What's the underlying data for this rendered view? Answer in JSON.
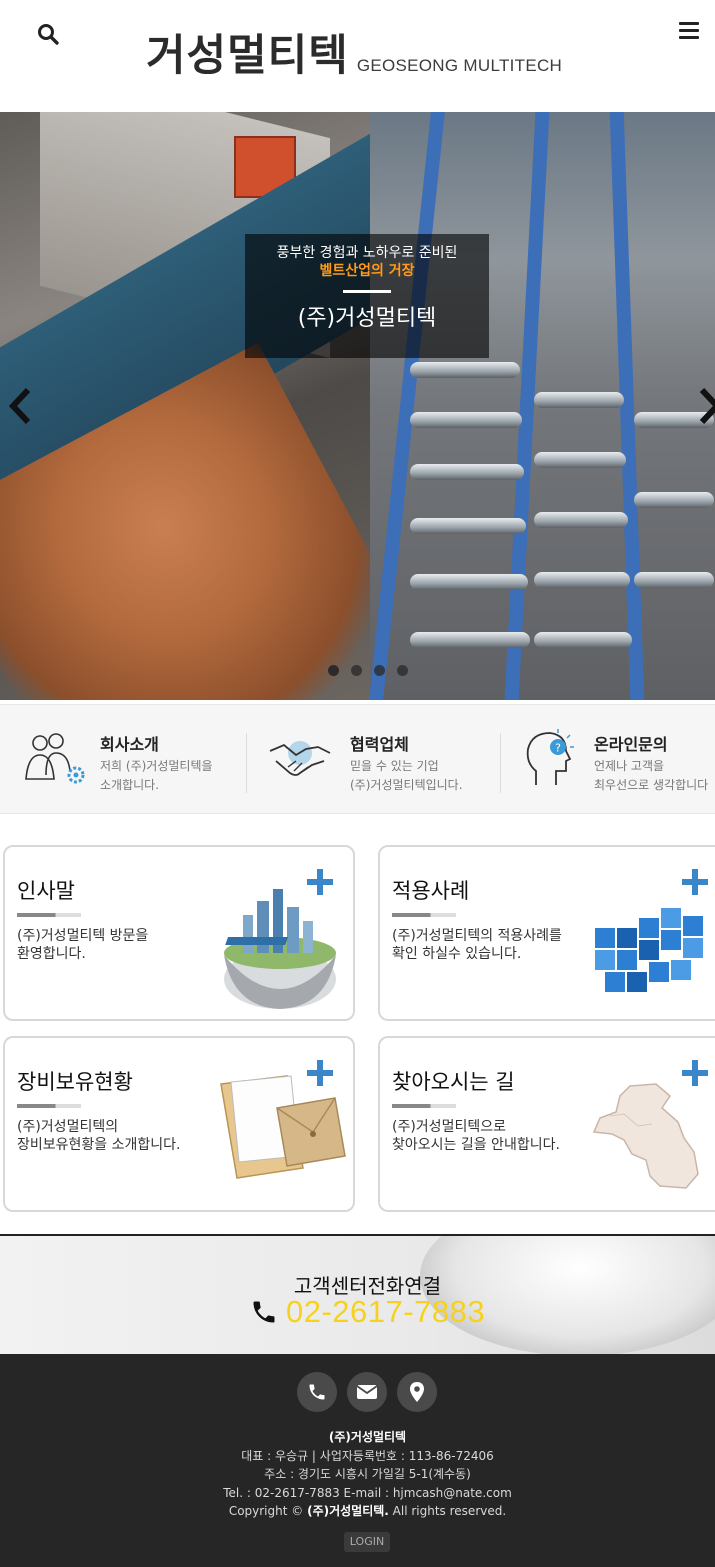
{
  "header": {
    "logo_korean": "거성멀티텍",
    "logo_english": "GEOSEONG MULTITECH",
    "search_icon": "search-icon",
    "menu_icon": "hamburger-menu-icon"
  },
  "hero": {
    "caption_line1": "풍부한 경험과 노하우로 준비된",
    "caption_line2": "벨트산업의 거장",
    "caption_line3": "(주)거성멀티텍",
    "highlight_color": "#ff9a1a",
    "prev_icon": "chevron-left-icon",
    "next_icon": "chevron-right-icon",
    "slide_count": 4,
    "active_slide": 1
  },
  "quick_menu": [
    {
      "title": "회사소개",
      "desc_line1": "저희 (주)거성멀티텍을",
      "desc_line2": "소개합니다.",
      "icon": "people-gear-icon"
    },
    {
      "title": "협력업체",
      "desc_line1": "믿을 수 있는 기업",
      "desc_line2": "(주)거성멀티텍입니다.",
      "icon": "handshake-icon"
    },
    {
      "title": "온라인문의",
      "desc_line1": "언제나 고객을",
      "desc_line2": "최우선으로 생각합니다",
      "icon": "head-question-icon"
    }
  ],
  "cards": [
    {
      "title": "인사말",
      "desc_line1": "(주)거성멀티텍 방문을",
      "desc_line2": "환영합니다.",
      "art": "city-globe-image"
    },
    {
      "title": "적용사례",
      "desc_line1": "(주)거성멀티텍의 적용사례를",
      "desc_line2": "확인 하실수 있습니다.",
      "art": "blue-cubes-image"
    },
    {
      "title": "장비보유현황",
      "desc_line1": "(주)거성멀티텍의",
      "desc_line2": "장비보유현황을 소개합니다.",
      "art": "document-folder-image"
    },
    {
      "title": "찾아오시는 길",
      "desc_line1": "(주)거성멀티텍으로",
      "desc_line2": "찾아오시는 길을 안내합니다.",
      "art": "korea-map-image"
    }
  ],
  "call_banner": {
    "title": "고객센터전화연결",
    "phone": "02-2617-7883",
    "phone_color": "#f6d21e",
    "phone_icon": "phone-icon"
  },
  "footer": {
    "icons": [
      "phone-icon",
      "envelope-icon",
      "map-pin-icon"
    ],
    "company": "(주)거성멀티텍",
    "line_ceo": "대표 : 우승규 | 사업자등록번호 : 113-86-72406",
    "line_address": "주소 : 경기도 시흥시 가일길 5-1(계수동)",
    "line_contact": "Tel. : 02-2617-7883 E-mail : hjmcash@nate.com",
    "copyright_prefix": "Copyright © ",
    "copyright_company": "(주)거성멀티텍.",
    "copyright_suffix": " All rights reserved.",
    "login_label": "LOGIN"
  }
}
